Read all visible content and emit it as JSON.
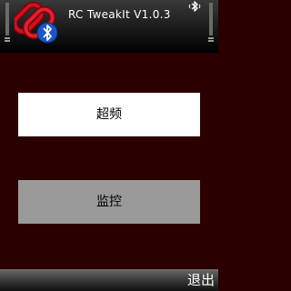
{
  "header": {
    "title": "RC TweakIt  V1.0.3",
    "app_icon": "chain-link-bluetooth-icon",
    "status_icon": "bluetooth-icon"
  },
  "main": {
    "buttons": [
      {
        "label": "超频"
      },
      {
        "label": "监控"
      }
    ]
  },
  "softkeys": {
    "right_label": "退出"
  },
  "colors": {
    "background": "#2a0000",
    "button_active": "#ffffff",
    "button_inactive": "#9a9a9a",
    "accent_red": "#c0101a",
    "bluetooth_blue": "#1a56c8"
  }
}
